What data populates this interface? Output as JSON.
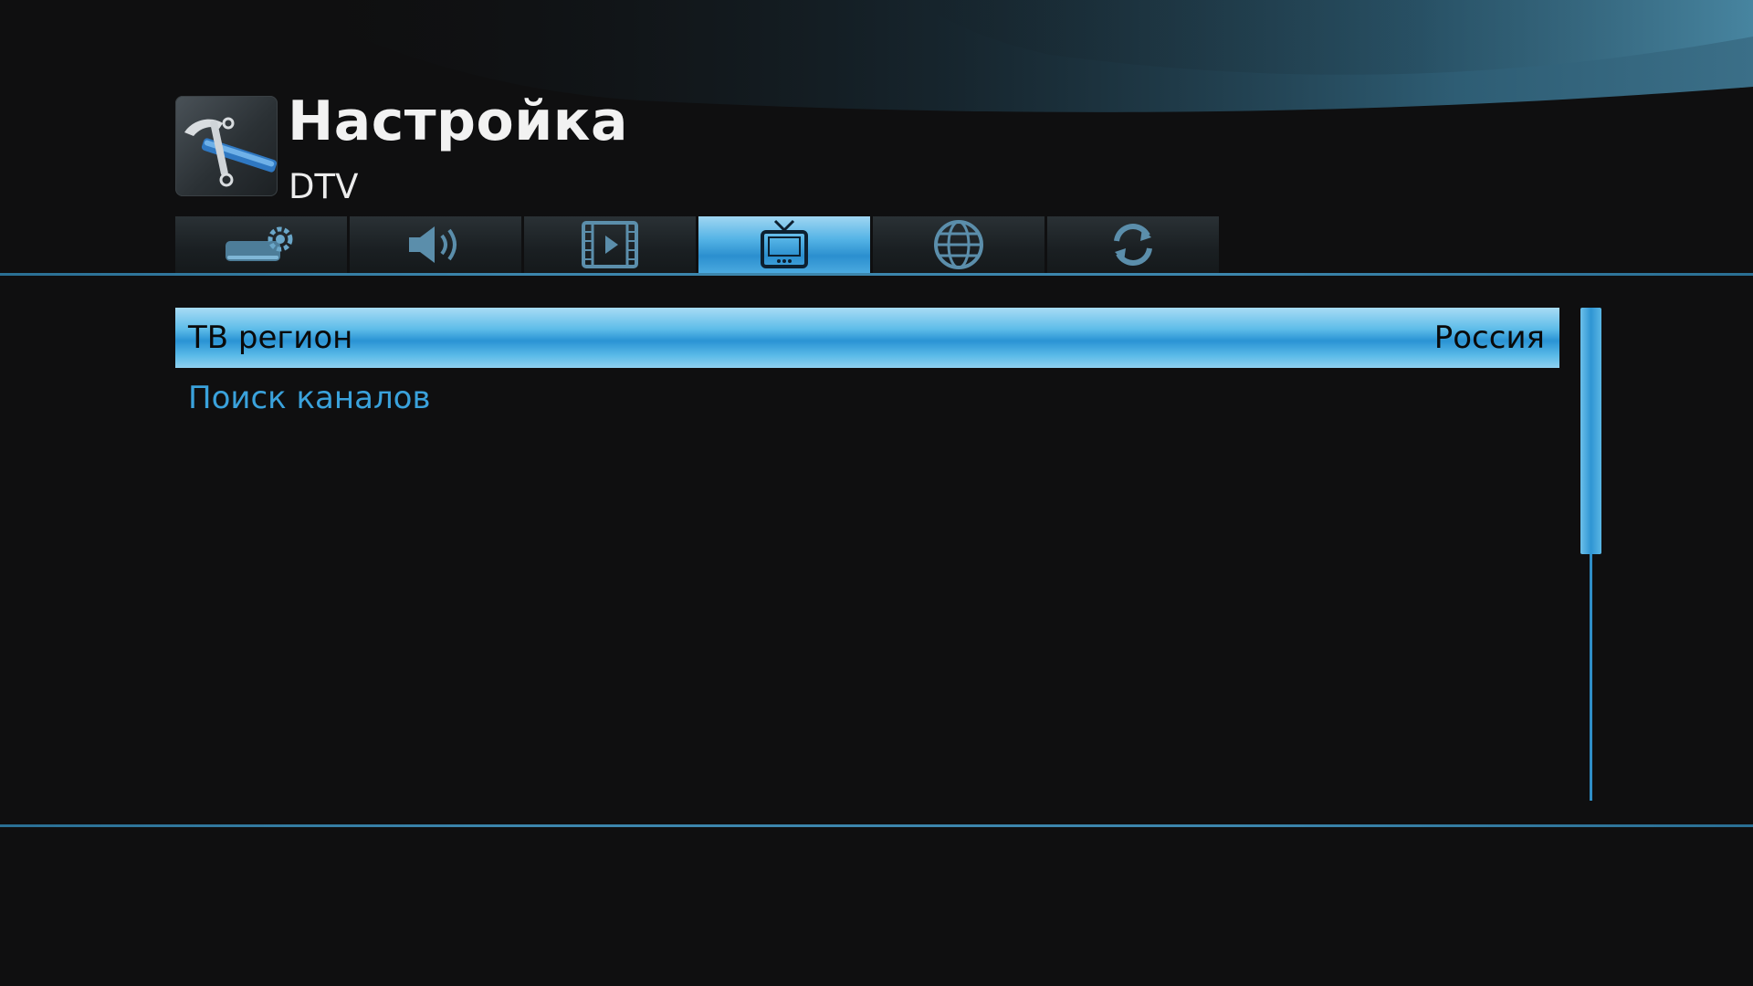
{
  "header": {
    "title": "Настройка",
    "subtitle": "DTV",
    "icon": "tools-icon"
  },
  "tabs": [
    {
      "name": "system",
      "icon": "system-settings-icon",
      "active": false
    },
    {
      "name": "audio",
      "icon": "speaker-icon",
      "active": false
    },
    {
      "name": "video",
      "icon": "film-icon",
      "active": false
    },
    {
      "name": "dtv",
      "icon": "tv-icon",
      "active": true
    },
    {
      "name": "network",
      "icon": "globe-icon",
      "active": false
    },
    {
      "name": "update",
      "icon": "refresh-icon",
      "active": false
    }
  ],
  "menu": {
    "items": [
      {
        "label": "ТВ регион",
        "value": "Россия",
        "selected": true
      },
      {
        "label": "Поиск каналов",
        "value": "",
        "selected": false
      }
    ]
  },
  "colors": {
    "accent": "#2b93d4",
    "background": "#0f0f10",
    "item_text": "#3aa2dc"
  }
}
